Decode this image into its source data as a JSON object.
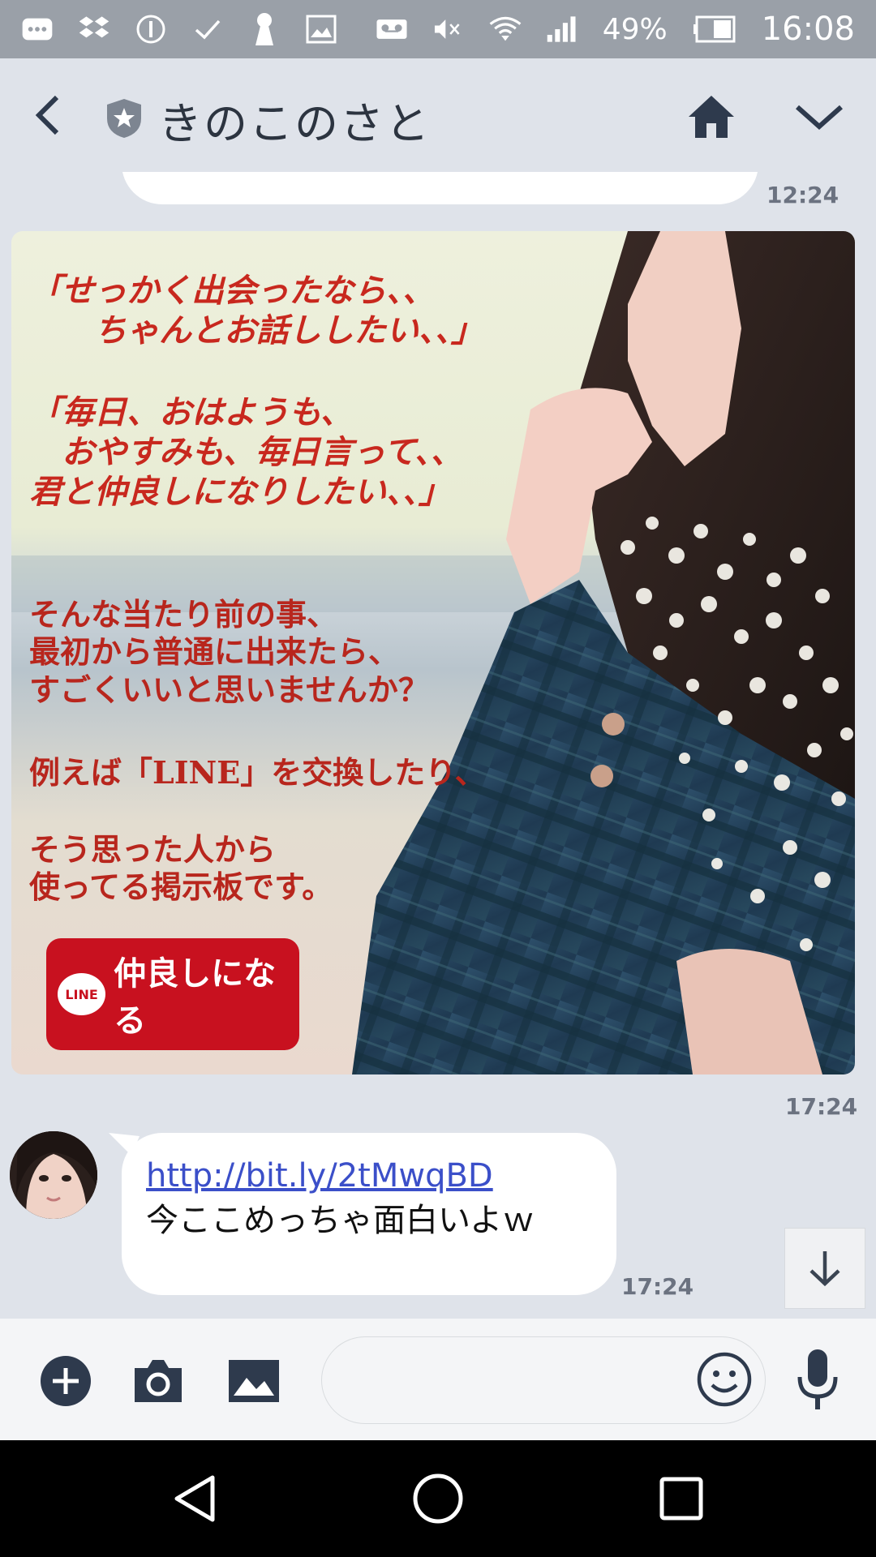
{
  "status_bar": {
    "battery_percent": "49%",
    "time": "16:08"
  },
  "header": {
    "title": "きのこのさと"
  },
  "messages": {
    "previous_timestamp": "12:24",
    "promo": {
      "quote1": "「せっかく出会ったなら、、\n　　ちゃんとお話ししたい、、」",
      "quote2": "「毎日、おはようも、\n　おやすみも、毎日言って、、\n君と仲良しになりしたい、、」",
      "body1": "そんな当たり前の事、\n最初から普通に出来たら、\nすごくいいと思いませんか？",
      "body2": "例えば「LINE」を交換したり、",
      "body3": "そう思った人から\n使ってる掲示板です。",
      "button_logo": "LINE",
      "button_label": "仲良しになる",
      "timestamp": "17:24"
    },
    "chat": {
      "link": "http://bit.ly/2tMwqBD",
      "text": "今ここめっちゃ面白いよｗ",
      "timestamp": "17:24"
    }
  },
  "input_bar": {
    "placeholder": ""
  },
  "colors": {
    "status_bar": "#9aa0a8",
    "background": "#dfe3ea",
    "icon_dark": "#2e3a4d",
    "promo_red": "#c8111f",
    "link_blue": "#3b4fc9"
  }
}
